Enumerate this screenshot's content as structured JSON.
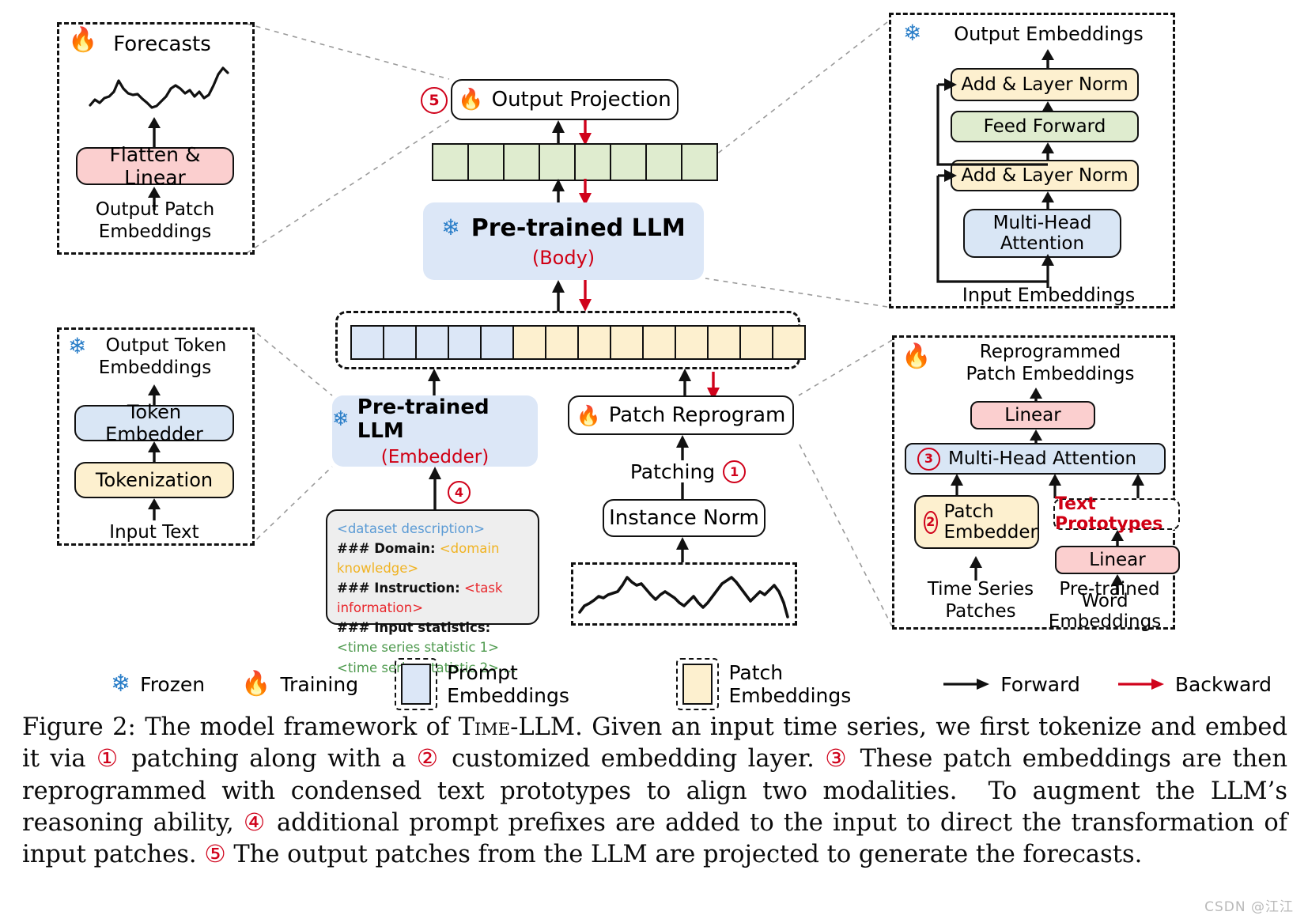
{
  "figure": {
    "caption_label": "Figure 2:",
    "caption_text": "The model framework of Time-LLM. Given an input time series, we first tokenize and embed it via ① patching along with a ② customized embedding layer. ③ These patch embeddings are then reprogrammed with condensed text prototypes to align two modalities. To augment the LLM's reasoning ability, ④ additional prompt prefixes are added to the input to direct the transformation of input patches. ⑤ The output patches from the LLM are projected to generate the forecasts.",
    "model_name": "Time-LLM",
    "watermark": "CSDN @江江"
  },
  "colors": {
    "yellow": "#fdf0cf",
    "green": "#dfeccf",
    "blue": "#d9e6f5",
    "pink": "#fbcfcf",
    "prompt_blue": "#dce7f7",
    "red_accent": "#d0021b",
    "snowflake_blue": "#2a7ec8"
  },
  "panel_forecasts": {
    "badge": "training-flame",
    "title": "Forecasts",
    "box_label": "Flatten & Linear",
    "bottom_label": "Output Patch\nEmbeddings",
    "bottom_label_l1": "Output Patch",
    "bottom_label_l2": "Embeddings"
  },
  "panel_token": {
    "badge": "frozen-snowflake",
    "title_l1": "Output Token",
    "title_l2": "Embeddings",
    "box_top": "Token Embedder",
    "box_bottom": "Tokenization",
    "bottom_label": "Input Text"
  },
  "panel_transformer": {
    "badge": "frozen-snowflake",
    "title": "Output Embeddings",
    "blocks": [
      {
        "label": "Add & Layer Norm",
        "color": "yellow"
      },
      {
        "label": "Feed Forward",
        "color": "green"
      },
      {
        "label": "Add & Layer Norm",
        "color": "yellow"
      },
      {
        "label": "Multi-Head\nAttention",
        "color": "blue",
        "l1": "Multi-Head",
        "l2": "Attention"
      }
    ],
    "bottom_label": "Input Embeddings"
  },
  "panel_reprogram": {
    "badge": "training-flame",
    "title_l1": "Reprogrammed",
    "title_l2": "Patch Embeddings",
    "linear_top": "Linear",
    "mha": {
      "number": "3",
      "label": "Multi-Head Attention"
    },
    "patch_embedder": {
      "number": "2",
      "l1": "Patch",
      "l2": "Embedder"
    },
    "text_prototypes": "Text Prototypes",
    "linear_bottom": "Linear",
    "bottom_left_l1": "Time Series",
    "bottom_left_l2": "Patches",
    "bottom_right_l1": "Pre-trained",
    "bottom_right_l2": "Word Embeddings"
  },
  "main": {
    "output_projection": {
      "number": "5",
      "label": "Output Projection",
      "badge": "training-flame"
    },
    "output_tokens_count": 8,
    "llm_body": {
      "title": "Pre-trained LLM",
      "subtitle": "(Body)",
      "badge": "frozen-snowflake"
    },
    "token_row": {
      "prompt_count": 5,
      "patch_count": 9
    },
    "llm_embedder": {
      "title": "Pre-trained LLM",
      "subtitle": "(Embedder)",
      "badge": "frozen-snowflake"
    },
    "patch_reprogram": {
      "label": "Patch Reprogram",
      "badge": "training-flame"
    },
    "patching_label": "Patching",
    "patching_number": "1",
    "instance_norm": "Instance Norm",
    "prompt_number": "4",
    "prompt_box": {
      "line1": "<dataset description>",
      "line2_key": "### Domain:",
      "line2_val": "<domain knowledge>",
      "line3_key": "### Instruction:",
      "line3_val": "<task information>",
      "line4_key": "### Input statistics:",
      "line5": "<time series statistic 1>",
      "line6": "<time series statistic 2>",
      "line6_ellipsis": "…"
    }
  },
  "legend": {
    "items": [
      {
        "icon": "frozen-snowflake",
        "label": "Frozen"
      },
      {
        "icon": "training-flame",
        "label": "Training"
      },
      {
        "icon": "prompt-swatch",
        "label": "Prompt Embeddings"
      },
      {
        "icon": "patch-swatch",
        "label": "Patch Embeddings"
      },
      {
        "icon": "black-arrow",
        "label": "Forward"
      },
      {
        "icon": "red-arrow",
        "label": "Backward"
      }
    ]
  }
}
